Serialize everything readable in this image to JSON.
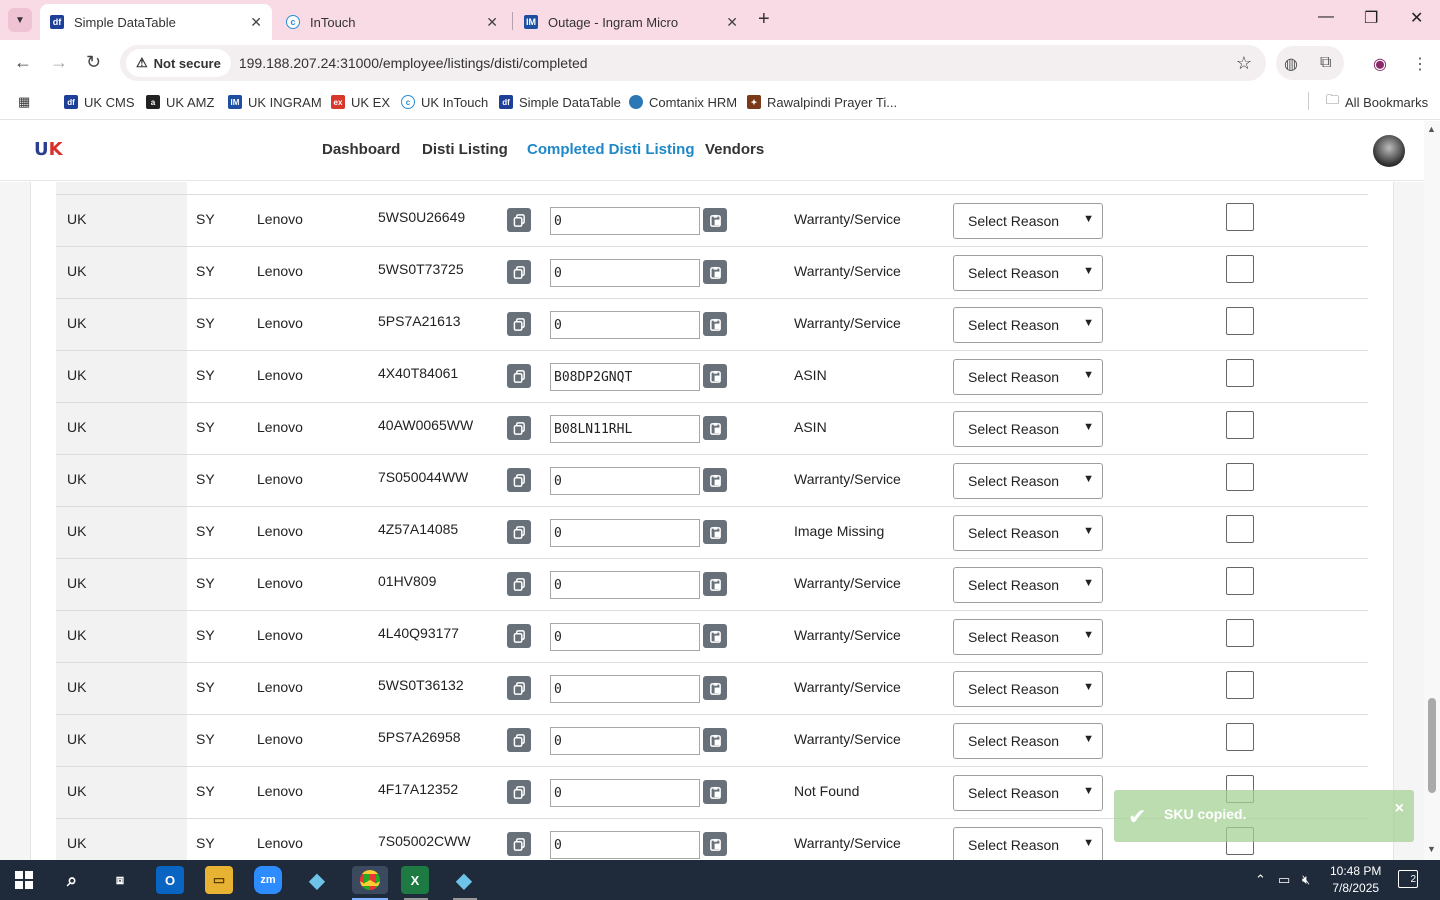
{
  "browser": {
    "tabs": [
      {
        "title": "Simple DataTable",
        "favicon": "df-icon",
        "active": true
      },
      {
        "title": "InTouch",
        "favicon": "intouch-icon",
        "active": false
      },
      {
        "title": "Outage - Ingram Micro",
        "favicon": "im-icon",
        "active": false
      }
    ],
    "security_label": "Not secure",
    "url": "199.188.207.24:31000/employee/listings/disti/completed",
    "bookmarks": [
      "UK CMS",
      "UK AMZ",
      "UK INGRAM",
      "UK EX",
      "UK InTouch",
      "Simple DataTable",
      "Comtanix HRM",
      "Rawalpindi Prayer Ti..."
    ],
    "all_bookmarks": "All Bookmarks"
  },
  "site": {
    "logo_text": "UK",
    "nav": [
      "Dashboard",
      "Disti Listing",
      "Completed Disti Listing",
      "Vendors"
    ],
    "active_nav": "Completed Disti Listing"
  },
  "table": {
    "rows": [
      {
        "region": "UK",
        "code": "SY",
        "brand": "Lenovo",
        "sku": "5WS0U26649",
        "asin": "0",
        "status": "Warranty/Service",
        "reason": "Select Reason"
      },
      {
        "region": "UK",
        "code": "SY",
        "brand": "Lenovo",
        "sku": "5WS0T73725",
        "asin": "0",
        "status": "Warranty/Service",
        "reason": "Select Reason"
      },
      {
        "region": "UK",
        "code": "SY",
        "brand": "Lenovo",
        "sku": "5PS7A21613",
        "asin": "0",
        "status": "Warranty/Service",
        "reason": "Select Reason"
      },
      {
        "region": "UK",
        "code": "SY",
        "brand": "Lenovo",
        "sku": "4X40T84061",
        "asin": "B08DP2GNQT",
        "status": "ASIN",
        "reason": "Select Reason"
      },
      {
        "region": "UK",
        "code": "SY",
        "brand": "Lenovo",
        "sku": "40AW0065WW",
        "asin": "B08LN11RHL",
        "status": "ASIN",
        "reason": "Select Reason"
      },
      {
        "region": "UK",
        "code": "SY",
        "brand": "Lenovo",
        "sku": "7S050044WW",
        "asin": "0",
        "status": "Warranty/Service",
        "reason": "Select Reason"
      },
      {
        "region": "UK",
        "code": "SY",
        "brand": "Lenovo",
        "sku": "4Z57A14085",
        "asin": "0",
        "status": "Image Missing",
        "reason": "Select Reason"
      },
      {
        "region": "UK",
        "code": "SY",
        "brand": "Lenovo",
        "sku": "01HV809",
        "asin": "0",
        "status": "Warranty/Service",
        "reason": "Select Reason"
      },
      {
        "region": "UK",
        "code": "SY",
        "brand": "Lenovo",
        "sku": "4L40Q93177",
        "asin": "0",
        "status": "Warranty/Service",
        "reason": "Select Reason"
      },
      {
        "region": "UK",
        "code": "SY",
        "brand": "Lenovo",
        "sku": "5WS0T36132",
        "asin": "0",
        "status": "Warranty/Service",
        "reason": "Select Reason"
      },
      {
        "region": "UK",
        "code": "SY",
        "brand": "Lenovo",
        "sku": "5PS7A26958",
        "asin": "0",
        "status": "Warranty/Service",
        "reason": "Select Reason"
      },
      {
        "region": "UK",
        "code": "SY",
        "brand": "Lenovo",
        "sku": "4F17A12352",
        "asin": "0",
        "status": "Not Found",
        "reason": "Select Reason"
      },
      {
        "region": "UK",
        "code": "SY",
        "brand": "Lenovo",
        "sku": "7S05002CWW",
        "asin": "0",
        "status": "Warranty/Service",
        "reason": "Select Reason"
      }
    ]
  },
  "toast": {
    "message": "SKU copied.",
    "close": "×"
  },
  "taskbar": {
    "time": "10:48 PM",
    "date": "7/8/2025",
    "notifications": "2"
  },
  "colors": {
    "accent": "#1e88c8",
    "tab_bar": "#f9dbe6",
    "toast": "#a4d296",
    "copy_button": "#68707a"
  }
}
